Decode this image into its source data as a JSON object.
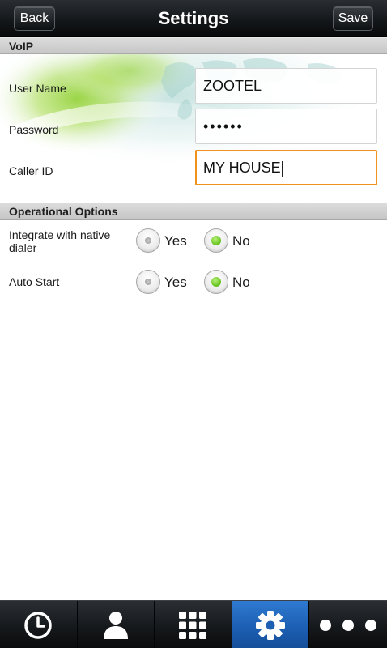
{
  "header": {
    "title": "Settings",
    "back_label": "Back",
    "save_label": "Save"
  },
  "voip": {
    "section_title": "VoIP",
    "fields": [
      {
        "label": "User Name",
        "value": "ZOOTEL"
      },
      {
        "label": "Password",
        "value": "••••••"
      },
      {
        "label": "Caller ID",
        "value": "MY HOUSE"
      }
    ]
  },
  "operational": {
    "section_title": "Operational Options",
    "options": [
      {
        "label": "Integrate with native dialer",
        "yes_label": "Yes",
        "no_label": "No",
        "selected": "No"
      },
      {
        "label": "Auto Start",
        "yes_label": "Yes",
        "no_label": "No",
        "selected": "No"
      }
    ]
  },
  "tabbar": {
    "tabs": [
      {
        "icon": "clock-icon",
        "active": false
      },
      {
        "icon": "person-icon",
        "active": false
      },
      {
        "icon": "keypad-icon",
        "active": false
      },
      {
        "icon": "gear-icon",
        "active": true
      },
      {
        "icon": "more-dots-icon",
        "active": false
      }
    ]
  },
  "colors": {
    "focus_border": "#f0931e",
    "radio_selected": "#62c11a",
    "active_tab": "#1c5fb3",
    "header_bg": "#15181b"
  }
}
